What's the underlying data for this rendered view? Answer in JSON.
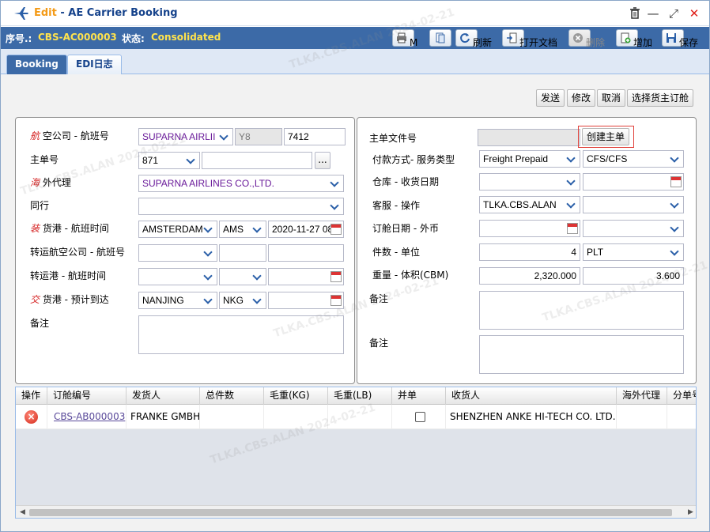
{
  "window": {
    "edit_label": "Edit",
    "title": " - AE Carrier Booking",
    "delete_icon": "trash-icon",
    "minimize": "—",
    "maximize": "⤢",
    "close": "✕"
  },
  "info": {
    "seq_label": "序号.:",
    "seq_value": "CBS-AC000003",
    "status_label": "状态:",
    "status_value": "Consolidated"
  },
  "toolbar": {
    "print_label": "M",
    "refresh_label": "刷新",
    "open_doc_label": "打开文档",
    "delete_label": "删除",
    "add_label": "增加",
    "save_label": "保存"
  },
  "tabs": [
    {
      "label": "Booking",
      "active": true
    },
    {
      "label": "EDI日志",
      "active": false
    }
  ],
  "actions": {
    "send": "发送",
    "modify": "修改",
    "cancel": "取消",
    "select_booking": "选择货主订舱"
  },
  "left": {
    "airline_prefix": "航",
    "airline_label": " 空公司 - 航班号",
    "airline_value": "SUPARNA AIRLII",
    "airline_code": "Y8",
    "flight_no": "7412",
    "mawb_label": "主单号",
    "mawb_prefix_value": "871",
    "mawb_number": "",
    "browse": "...",
    "agent_prefix": "海",
    "agent_label": " 外代理",
    "agent_value": "SUPARNA AIRLINES CO.,LTD.",
    "peer_label": "同行",
    "peer_value": "",
    "lport_prefix": "装",
    "lport_label": " 货港 - 航班时间",
    "lport_value": "AMSTERDAM",
    "lport_code": "AMS",
    "lport_time": "2020-11-27 08:",
    "trans_air_label": "转运航空公司 - 航班号",
    "trans_port_label": "转运港 - 航班时间",
    "dport_prefix": "交",
    "dport_label": " 货港 - 预计到达",
    "dport_value": "NANJING",
    "dport_code": "NKG",
    "remark_label": "备注"
  },
  "right": {
    "mawb_file_label": "主单文件号",
    "create_master_label": "创建主单",
    "payment_label": "付款方式- 服务类型",
    "payment_value": "Freight Prepaid",
    "service_value": "CFS/CFS",
    "warehouse_label": "仓库 - 收货日期",
    "cs_label": "客服 - 操作",
    "cs_value": "TLKA.CBS.ALAN",
    "booking_date_label": "订舱日期 - 外币",
    "pieces_label": "件数 - 单位",
    "pieces_value": "4",
    "unit_value": "PLT",
    "weight_label": "重量 - 体积(CBM)",
    "weight_value": "2,320.000",
    "volume_value": "3.600",
    "remark1_label": "备注",
    "remark2_label": "备注"
  },
  "grid": {
    "columns": [
      "操作",
      "订舱编号",
      "发货人",
      "总件数",
      "毛重(KG)",
      "毛重(LB)",
      "并单",
      "收货人",
      "海外代理",
      "分单号"
    ],
    "rows": [
      {
        "booking_no": "CBS-AB000003",
        "shipper": "FRANKE GMBH",
        "pieces": "",
        "kg": "",
        "lb": "",
        "consignee": "SHENZHEN ANKE HI-TECH CO. LTD.",
        "agent": "",
        "hawb": ""
      }
    ],
    "scroll_left": "◀",
    "scroll_right": "▶"
  },
  "watermark": "TLKA.CBS.ALAN 2024-02-21",
  "colors": {
    "accent": "#3c6aa7",
    "status": "#ffe34d",
    "edit": "#f49a16"
  }
}
